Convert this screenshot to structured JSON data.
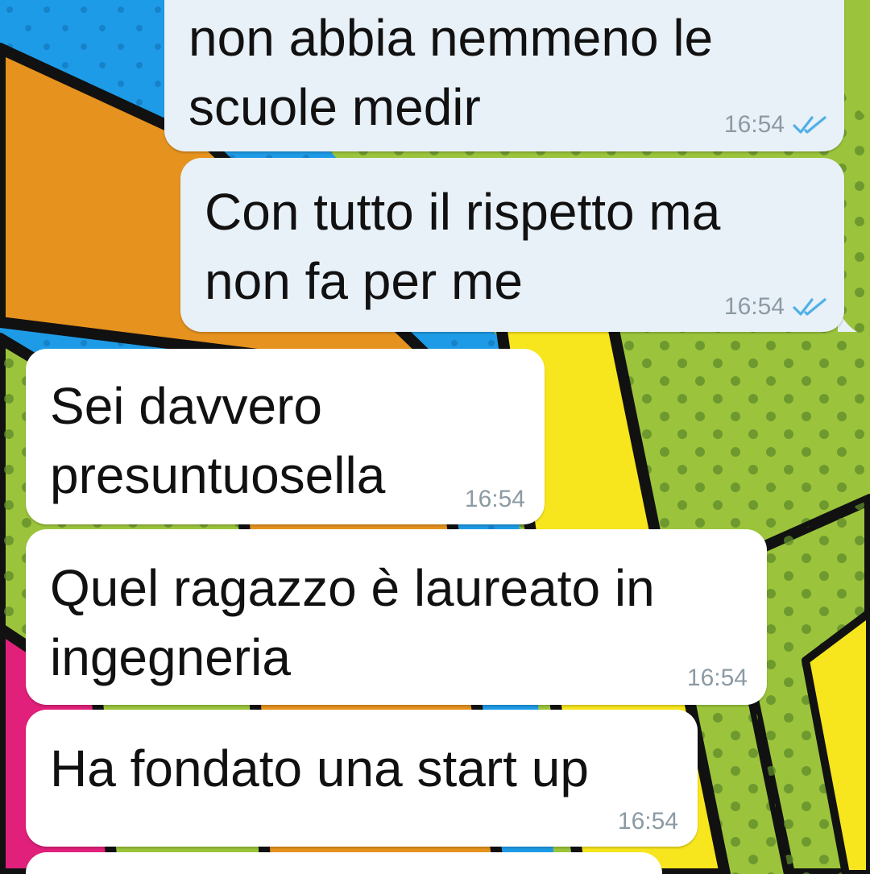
{
  "messages": [
    {
      "direction": "outgoing",
      "text": "non abbia nemmeno le\nscuole medir",
      "time": "16:54",
      "status": "read"
    },
    {
      "direction": "outgoing",
      "text": "Con tutto il rispetto ma\nnon fa per me",
      "time": "16:54",
      "status": "read"
    },
    {
      "direction": "incoming",
      "text": "Sei davvero\npresuntuosella",
      "time": "16:54"
    },
    {
      "direction": "incoming",
      "text": "Quel ragazzo è laureato in\ningegneria",
      "time": "16:54"
    },
    {
      "direction": "incoming",
      "text": "Ha fondato una start up",
      "time": "16:54"
    },
    {
      "direction": "incoming",
      "text": "",
      "time": ""
    }
  ],
  "icons": {
    "read_receipt": "double-check-icon"
  },
  "colors": {
    "outgoing_bubble": "#e8f0f8",
    "incoming_bubble": "#ffffff",
    "timestamp": "#8c9aa3",
    "read_ticks": "#4fb0e6",
    "wallpaper_green": "#9bc43c",
    "wallpaper_blue": "#1e9be6",
    "wallpaper_orange": "#e6921e",
    "wallpaper_yellow": "#f7e51d",
    "wallpaper_pink": "#e0207a"
  }
}
